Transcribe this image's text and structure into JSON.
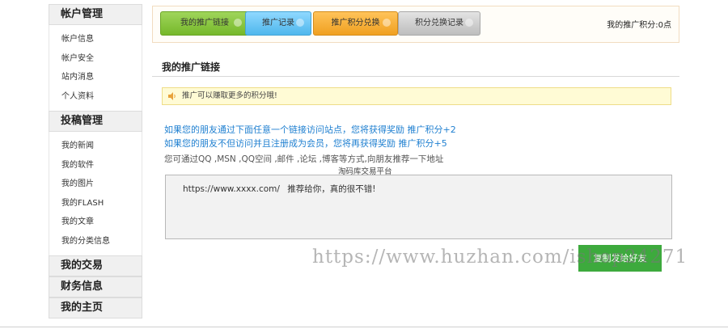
{
  "sidebar": {
    "account": {
      "title": "帐户管理",
      "items": [
        "帐户信息",
        "帐户安全",
        "站内消息",
        "个人资料"
      ]
    },
    "contribute": {
      "title": "投稿管理",
      "items": [
        "我的新闻",
        "我的软件",
        "我的图片",
        "我的FLASH",
        "我的文章",
        "我的分类信息"
      ]
    },
    "sections": [
      "我的交易",
      "财务信息",
      "我的主页"
    ]
  },
  "tabs": [
    {
      "label": "我的推广链接",
      "color": "#76b82a"
    },
    {
      "label": "推广记录",
      "color": "#4fb7ec"
    },
    {
      "label": "推广积分兑换",
      "color": "#f0a020"
    },
    {
      "label": "积分兑换记录",
      "color": "#bdbdbd"
    }
  ],
  "points_text": "我的推广积分:0点",
  "main": {
    "title": "我的推广链接",
    "notice": "推广可以赚取更多的积分哦!",
    "line1": "如果您的朋友通过下面任意一个链接访问站点，您将获得奖励 推广积分+2",
    "line2": "如果您的朋友不但访问并且注册成为会员，您将再获得奖励 推广积分+5",
    "hint": "您可通过QQ ,MSN ,QQ空间 ,邮件 ,论坛 ,博客等方式,向朋友推荐一下地址",
    "platform": "淘码库交易平台",
    "share_link": "https://www.xxxx.com/",
    "share_text": "推荐给你，真的很不错!",
    "copy_button": "复制发给好友"
  },
  "watermark": "https://www.huzhan.com/ishop24271",
  "colors": {
    "copy_button": "#3daa3d",
    "notice_bg": "#fffbd5",
    "link_blue": "#1e7fd0"
  }
}
